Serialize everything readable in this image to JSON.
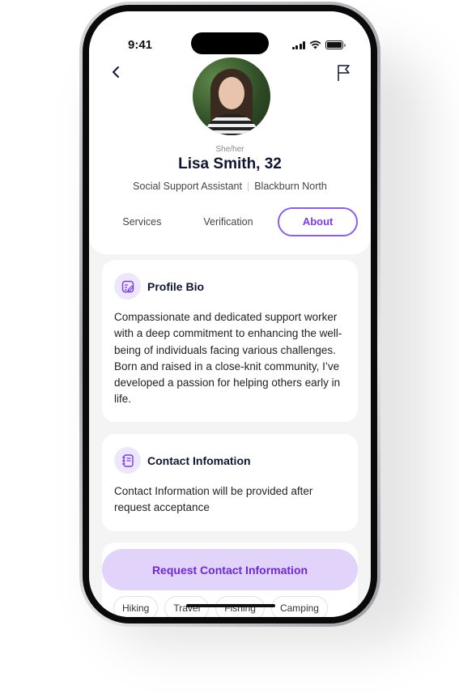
{
  "status_bar": {
    "time": "9:41"
  },
  "header": {
    "back_icon": "chevron-left-icon",
    "report_icon": "flag-icon"
  },
  "profile": {
    "pronouns": "She/her",
    "name": "Lisa Smith, 32",
    "role": "Social Support Assistant",
    "separator": "|",
    "location": "Blackburn North"
  },
  "tabs": [
    {
      "label": "Services",
      "active": false
    },
    {
      "label": "Verification",
      "active": false
    },
    {
      "label": "About",
      "active": true
    }
  ],
  "bio_card": {
    "icon": "edit-note-icon",
    "title": "Profile Bio",
    "body": "Compassionate and dedicated support worker with a deep commitment to enhancing the well-being of individuals facing various challenges. Born and raised in a close-knit community, I’ve developed a passion for helping others early in life."
  },
  "contact_card": {
    "icon": "notebook-icon",
    "title": "Contact Infomation",
    "body": "Contact Information will be provided after request acceptance"
  },
  "actions": {
    "request_contact_label": "Request Contact Information"
  },
  "interests": [
    "Hiking",
    "Travel",
    "Fishing",
    "Camping"
  ],
  "colors": {
    "accent": "#7c3aed",
    "accent_light": "#e1d3f9",
    "heading": "#0f1633"
  }
}
